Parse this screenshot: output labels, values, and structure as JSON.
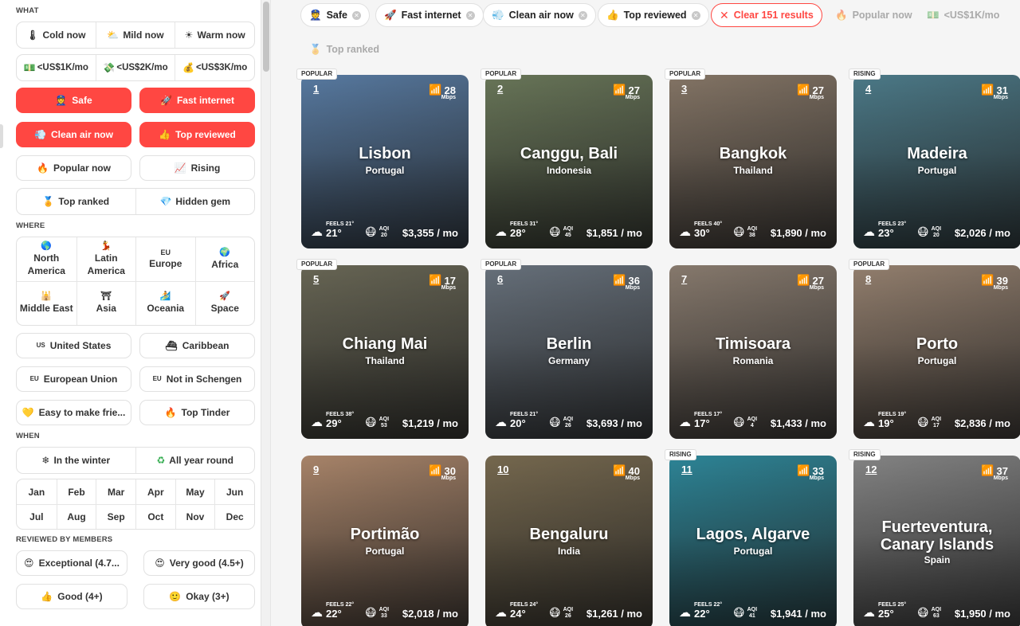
{
  "sidebar": {
    "what_title": "WHAT",
    "temps": [
      {
        "icon": "thermometer-cold-icon",
        "glyph": "🌡",
        "label": "Cold now"
      },
      {
        "icon": "cloud-sun-icon",
        "glyph": "⛅",
        "label": "Mild now"
      },
      {
        "icon": "sun-icon",
        "glyph": "☀",
        "label": "Warm now"
      }
    ],
    "costs": [
      {
        "icon": "banknote-icon",
        "glyph": "💵",
        "label": "<US$1K/mo"
      },
      {
        "icon": "money-icon",
        "glyph": "💸",
        "label": "<US$2K/mo"
      },
      {
        "icon": "moneybag-icon",
        "glyph": "💰",
        "label": "<US$3K/mo"
      }
    ],
    "safe": {
      "glyph": "👮",
      "label": "Safe"
    },
    "fast_internet": {
      "glyph": "🚀",
      "label": "Fast internet"
    },
    "clean_air": {
      "glyph": "💨",
      "label": "Clean air now"
    },
    "top_reviewed": {
      "glyph": "👍",
      "label": "Top reviewed"
    },
    "popular_now": {
      "glyph": "🔥",
      "label": "Popular now"
    },
    "rising": {
      "glyph": "📈",
      "label": "Rising"
    },
    "top_ranked": {
      "glyph": "🏅",
      "label": "Top ranked"
    },
    "hidden_gem": {
      "glyph": "💎",
      "label": "Hidden gem"
    },
    "where_title": "WHERE",
    "regions": [
      {
        "glyph": "🌎",
        "label": "North America"
      },
      {
        "glyph": "💃",
        "label": "Latin America"
      },
      {
        "glyph": "EU",
        "label": "Europe"
      },
      {
        "glyph": "🌍",
        "label": "Africa"
      },
      {
        "glyph": "🕌",
        "label": "Middle East"
      },
      {
        "glyph": "⛩",
        "label": "Asia"
      },
      {
        "glyph": "🏄",
        "label": "Oceania"
      },
      {
        "glyph": "🚀",
        "label": "Space"
      }
    ],
    "united_states": {
      "glyph": "US",
      "label": "United States"
    },
    "caribbean": {
      "glyph": "⛴",
      "label": "Caribbean"
    },
    "european_union": {
      "glyph": "EU",
      "label": "European Union"
    },
    "not_schengen": {
      "glyph": "EU",
      "label": "Not in Schengen"
    },
    "easy_friends": {
      "glyph": "💛",
      "label": "Easy to make frie..."
    },
    "top_tinder": {
      "glyph": "🔥",
      "label": "Top Tinder"
    },
    "when_title": "WHEN",
    "in_winter": {
      "glyph": "❄",
      "label": "In the winter"
    },
    "all_year": {
      "glyph": "♻",
      "label": "All year round"
    },
    "months": [
      "Jan",
      "Feb",
      "Mar",
      "Apr",
      "May",
      "Jun",
      "Jul",
      "Aug",
      "Sep",
      "Oct",
      "Nov",
      "Dec"
    ],
    "reviewed_title": "REVIEWED BY MEMBERS",
    "exceptional": {
      "glyph": "😍",
      "label": "Exceptional (4.7..."
    },
    "very_good": {
      "glyph": "😍",
      "label": "Very good (4.5+)"
    },
    "good": {
      "glyph": "👍",
      "label": "Good (4+)"
    },
    "okay": {
      "glyph": "🙂",
      "label": "Okay (3+)"
    }
  },
  "filters": {
    "safe": {
      "glyph": "👮",
      "label": "Safe"
    },
    "fast_internet": {
      "glyph": "🚀",
      "label": "Fast internet"
    },
    "clean_air": {
      "glyph": "💨",
      "label": "Clean air now"
    },
    "top_reviewed": {
      "glyph": "👍",
      "label": "Top reviewed"
    },
    "clear": {
      "glyph": "✕",
      "label": "Clear 151 results"
    },
    "popular_now": {
      "glyph": "🔥",
      "label": "Popular now"
    },
    "cost": {
      "glyph": "💵",
      "label": "<US$1K/mo"
    },
    "top_ranked": {
      "glyph": "🏅",
      "label": "Top ranked"
    }
  },
  "cards": [
    {
      "badge": "POPULAR",
      "rank": "1",
      "mbps": "28",
      "city": "Lisbon",
      "country": "Portugal",
      "feels": "FEELS 21°",
      "temp": "21°",
      "aqi": "20",
      "cost": "$3,355 / mo",
      "color": "#5b7fa8"
    },
    {
      "badge": "POPULAR",
      "rank": "2",
      "mbps": "27",
      "city": "Canggu, Bali",
      "country": "Indonesia",
      "feels": "FEELS 31°",
      "temp": "28°",
      "aqi": "45",
      "cost": "$1,851 / mo",
      "color": "#6d7b5c"
    },
    {
      "badge": "POPULAR",
      "rank": "3",
      "mbps": "27",
      "city": "Bangkok",
      "country": "Thailand",
      "feels": "FEELS 40°",
      "temp": "30°",
      "aqi": "38",
      "cost": "$1,890 / mo",
      "color": "#8a7a6a"
    },
    {
      "badge": "RISING",
      "rank": "4",
      "mbps": "31",
      "city": "Madeira",
      "country": "Portugal",
      "feels": "FEELS 23°",
      "temp": "23°",
      "aqi": "20",
      "cost": "$2,026 / mo",
      "color": "#4f7f8e"
    },
    {
      "badge": "POPULAR",
      "rank": "5",
      "mbps": "17",
      "city": "Chiang Mai",
      "country": "Thailand",
      "feels": "FEELS 38°",
      "temp": "29°",
      "aqi": "53",
      "cost": "$1,219 / mo",
      "color": "#6c6a58"
    },
    {
      "badge": "POPULAR",
      "rank": "6",
      "mbps": "36",
      "city": "Berlin",
      "country": "Germany",
      "feels": "FEELS 21°",
      "temp": "20°",
      "aqi": "26",
      "cost": "$3,693 / mo",
      "color": "#6b7580"
    },
    {
      "badge": "",
      "rank": "7",
      "mbps": "27",
      "city": "Timisoara",
      "country": "Romania",
      "feels": "FEELS 17°",
      "temp": "17°",
      "aqi": "4",
      "cost": "$1,433 / mo",
      "color": "#8d7f72"
    },
    {
      "badge": "POPULAR",
      "rank": "8",
      "mbps": "39",
      "city": "Porto",
      "country": "Portugal",
      "feels": "FEELS 19°",
      "temp": "19°",
      "aqi": "17",
      "cost": "$2,836 / mo",
      "color": "#9a8573"
    },
    {
      "badge": "",
      "rank": "9",
      "mbps": "30",
      "city": "Portimão",
      "country": "Portugal",
      "feels": "FEELS 22°",
      "temp": "22°",
      "aqi": "33",
      "cost": "$2,018 / mo",
      "color": "#b08a6e"
    },
    {
      "badge": "",
      "rank": "10",
      "mbps": "40",
      "city": "Bengaluru",
      "country": "India",
      "feels": "FEELS 24°",
      "temp": "24°",
      "aqi": "26",
      "cost": "$1,261 / mo",
      "color": "#7b6d52"
    },
    {
      "badge": "RISING",
      "rank": "11",
      "mbps": "33",
      "city": "Lagos, Algarve",
      "country": "Portugal",
      "feels": "FEELS 22°",
      "temp": "22°",
      "aqi": "41",
      "cost": "$1,941 / mo",
      "color": "#2f8b9e"
    },
    {
      "badge": "RISING",
      "rank": "12",
      "mbps": "37",
      "city": "Fuerteventura, Canary Islands",
      "country": "Spain",
      "feels": "FEELS 25°",
      "temp": "25°",
      "aqi": "63",
      "cost": "$1,950 / mo",
      "color": "#8a8a8a"
    }
  ],
  "card_labels": {
    "mbps_unit": "Mbps",
    "aqi_label": "AQI"
  }
}
